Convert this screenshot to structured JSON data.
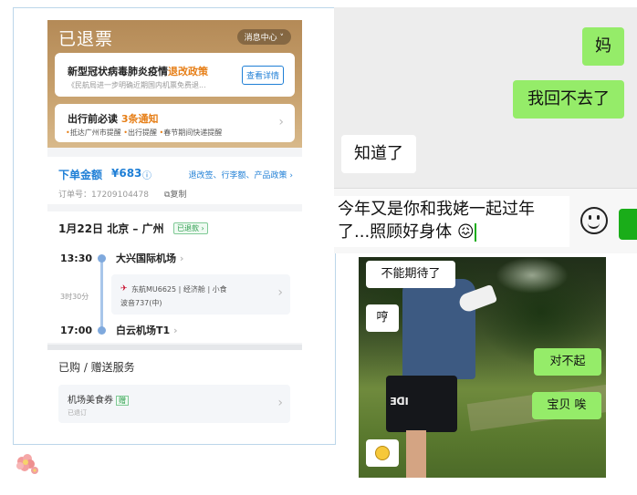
{
  "ticket": {
    "status_title": "已退票",
    "message_center": "消息中心 ˅",
    "policy": {
      "title_prefix": "新型冠状病毒肺炎疫情",
      "title_highlight": "退改政策",
      "subtitle": "《民航局进一步明确近期国内机票免费退...",
      "button": "查看详情"
    },
    "notice": {
      "title_prefix": "出行前必读",
      "title_highlight": "3条通知",
      "items": [
        "抵达广州市提醒",
        "出行提醒",
        "春节期间快递提醒"
      ]
    },
    "order": {
      "price_label": "下单金额",
      "price_value": "¥683",
      "links": "退改签、行李额、产品政策",
      "order_number": "订单号：17209104478",
      "copy": "复制"
    },
    "flight": {
      "route": "1月22日 北京 – 广州",
      "badge": "已退款",
      "dep_time": "13:30",
      "dep_airport": "大兴国际机场",
      "duration": "3时30分",
      "airline_info": "东航MU6625 | 经济舱 | 小食",
      "aircraft": "波音737(中)",
      "arr_time": "17:00",
      "arr_airport": "白云机场T1"
    },
    "services": {
      "title": "已购 / 赠送服务",
      "item_name": "机场美食券",
      "item_tag": "赠",
      "item_status": "已退订"
    }
  },
  "chat": {
    "messages": [
      {
        "side": "right",
        "text": "妈"
      },
      {
        "side": "right",
        "text": "我回不去了"
      },
      {
        "side": "left",
        "text": "知道了"
      }
    ],
    "input_text": "今年又是你和我姥一起过年了...照顾好身体",
    "input_emoji": "😖"
  },
  "meme": {
    "bubbles": [
      "不能期待了",
      "哼",
      "对不起",
      "宝贝 唉"
    ],
    "shorts_text": "ƎᗡI"
  },
  "colors": {
    "accent_blue": "#1f7fd6",
    "highlight_orange": "#e67e16",
    "wechat_green": "#95ec69",
    "hero_gold": "#c7a06c"
  }
}
